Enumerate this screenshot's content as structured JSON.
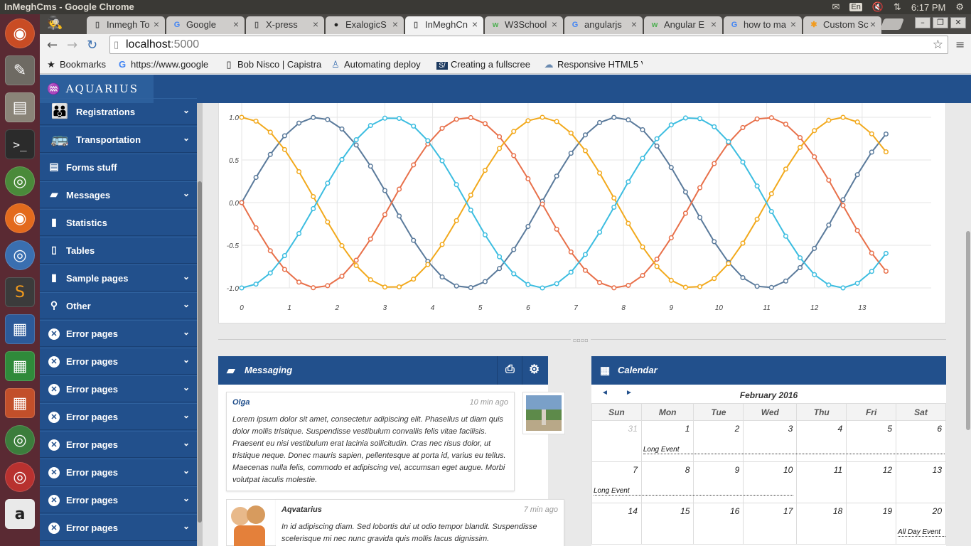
{
  "os": {
    "window_title": "InMeghCms - Google Chrome",
    "lang": "En",
    "time": "6:17 PM"
  },
  "tabs": [
    {
      "label": "Inmegh To",
      "favicon": "doc-icon"
    },
    {
      "label": "Google",
      "favicon": "google-icon"
    },
    {
      "label": "X-press",
      "favicon": "doc-icon"
    },
    {
      "label": "ExalogicS",
      "favicon": "github-icon"
    },
    {
      "label": "InMeghCn",
      "favicon": "doc-icon",
      "active": true
    },
    {
      "label": "W3School",
      "favicon": "w3schools-icon"
    },
    {
      "label": "angularjs",
      "favicon": "google-icon"
    },
    {
      "label": "Angular E",
      "favicon": "w3schools-icon"
    },
    {
      "label": "how to ma",
      "favicon": "google-icon"
    },
    {
      "label": "Custom Sc",
      "favicon": "star-icon"
    }
  ],
  "omnibox": {
    "host": "localhost",
    "port": ":5000"
  },
  "bookmarks": [
    {
      "label": "Bookmarks",
      "icon": "star-icon"
    },
    {
      "label": "https://www.google",
      "icon": "google-icon"
    },
    {
      "label": "Bob Nisco | Capistra",
      "icon": "doc-icon"
    },
    {
      "label": "Automating deploy",
      "icon": "rocket-icon"
    },
    {
      "label": "Creating a fullscree",
      "icon": "s-icon"
    },
    {
      "label": "Responsive HTML5 V",
      "icon": "cloud-icon"
    }
  ],
  "app": {
    "logo": "AQUARIUS"
  },
  "sidebar": {
    "items": [
      {
        "label": "Registrations",
        "icon": "people-icon",
        "has_children": true
      },
      {
        "label": "Transportation",
        "icon": "bus-icon",
        "has_children": true
      },
      {
        "label": "Forms stuff",
        "icon": "form-icon",
        "has_children": false
      },
      {
        "label": "Messages",
        "icon": "chat-icon",
        "has_children": true
      },
      {
        "label": "Statistics",
        "icon": "bar-chart-icon",
        "has_children": false
      },
      {
        "label": "Tables",
        "icon": "document-icon",
        "has_children": false
      },
      {
        "label": "Sample pages",
        "icon": "pages-icon",
        "has_children": true
      },
      {
        "label": "Other",
        "icon": "search-icon",
        "has_children": true
      },
      {
        "label": "Error pages",
        "icon": "error-icon",
        "has_children": true
      },
      {
        "label": "Error pages",
        "icon": "error-icon",
        "has_children": true
      },
      {
        "label": "Error pages",
        "icon": "error-icon",
        "has_children": true
      },
      {
        "label": "Error pages",
        "icon": "error-icon",
        "has_children": true
      },
      {
        "label": "Error pages",
        "icon": "error-icon",
        "has_children": true
      },
      {
        "label": "Error pages",
        "icon": "error-icon",
        "has_children": true
      },
      {
        "label": "Error pages",
        "icon": "error-icon",
        "has_children": true
      },
      {
        "label": "Error pages",
        "icon": "error-icon",
        "has_children": true
      }
    ]
  },
  "chart_data": {
    "type": "line",
    "xlim": [
      0,
      14
    ],
    "ylim": [
      -1.0,
      1.0
    ],
    "x_ticks": [
      "0",
      "1",
      "2",
      "3",
      "4",
      "5",
      "6",
      "7",
      "8",
      "9",
      "10",
      "11",
      "12",
      "13"
    ],
    "y_ticks": [
      "1.0",
      "0.5",
      "0.0",
      "-0.5",
      "-1.0"
    ],
    "grid": true,
    "x": [
      0,
      0.3,
      0.6,
      0.9,
      1.2,
      1.5,
      1.8,
      2.1,
      2.4,
      2.7,
      3.0,
      3.3,
      3.6,
      3.9,
      4.2,
      4.5,
      4.8,
      5.1,
      5.4,
      5.7,
      6.0,
      6.3,
      6.6,
      6.9,
      7.2,
      7.5,
      7.8,
      8.1,
      8.4,
      8.7,
      9.0,
      9.3,
      9.6,
      9.9,
      10.2,
      10.5,
      10.8,
      11.1,
      11.4,
      11.7,
      12.0,
      12.3,
      12.6,
      12.9,
      13.2,
      13.5
    ],
    "series": [
      {
        "color": "#5a7a9b",
        "values": [
          0,
          0.2955,
          0.5646,
          0.7833,
          0.932,
          0.9975,
          0.9738,
          0.8632,
          0.6755,
          0.4274,
          0.1411,
          -0.1577,
          -0.4425,
          -0.6878,
          -0.8716,
          -0.9775,
          -0.9962,
          -0.9258,
          -0.7728,
          -0.5507,
          -0.2794,
          0.0168,
          0.3115,
          0.5784,
          0.7937,
          0.938,
          0.9985,
          0.9699,
          0.8546,
          0.6628,
          0.4121,
          0.1245,
          -0.1743,
          -0.4575,
          -0.6999,
          -0.8797,
          -0.9809,
          -0.9946,
          -0.9193,
          -0.7619,
          -0.5366,
          -0.2632,
          0.0336,
          0.3275,
          0.592,
          0.8038
        ]
      },
      {
        "color": "#e8704a",
        "values": [
          0,
          -0.2955,
          -0.5646,
          -0.7833,
          -0.932,
          -0.9975,
          -0.9738,
          -0.8632,
          -0.6755,
          -0.4274,
          -0.1411,
          0.1577,
          0.4425,
          0.6878,
          0.8716,
          0.9775,
          0.9962,
          0.9258,
          0.7728,
          0.5507,
          0.2794,
          -0.0168,
          -0.3115,
          -0.5784,
          -0.7937,
          -0.938,
          -0.9985,
          -0.9699,
          -0.8546,
          -0.6628,
          -0.4121,
          -0.1245,
          0.1743,
          0.4575,
          0.6999,
          0.8797,
          0.9809,
          0.9946,
          0.9193,
          0.7619,
          0.5366,
          0.2632,
          -0.0336,
          -0.3275,
          -0.592,
          -0.8038
        ]
      },
      {
        "color": "#f2a91c",
        "values": [
          1,
          0.9553,
          0.8253,
          0.6216,
          0.3624,
          0.0707,
          -0.2272,
          -0.5048,
          -0.7374,
          -0.9041,
          -0.99,
          -0.9875,
          -0.8968,
          -0.7259,
          -0.4903,
          -0.2108,
          0.0875,
          0.378,
          0.6347,
          0.8347,
          0.9602,
          0.9999,
          0.9502,
          0.8157,
          0.6084,
          0.3466,
          0.054,
          -0.2435,
          -0.5193,
          -0.7487,
          -0.9111,
          -0.9922,
          -0.9847,
          -0.8892,
          -0.7143,
          -0.4755,
          -0.1943,
          0.1042,
          0.3935,
          0.6476,
          0.8439,
          0.9648,
          0.9994,
          0.9449,
          0.8059,
          0.595
        ]
      },
      {
        "color": "#3cbde0",
        "values": [
          -1,
          -0.9553,
          -0.8253,
          -0.6216,
          -0.3624,
          -0.0707,
          0.2272,
          0.5048,
          0.7374,
          0.9041,
          0.99,
          0.9875,
          0.8968,
          0.7259,
          0.4903,
          0.2108,
          -0.0875,
          -0.378,
          -0.6347,
          -0.8347,
          -0.9602,
          -0.9999,
          -0.9502,
          -0.8157,
          -0.6084,
          -0.3466,
          -0.054,
          0.2435,
          0.5193,
          0.7487,
          0.9111,
          0.9922,
          0.9847,
          0.8892,
          0.7143,
          0.4755,
          0.1943,
          -0.1042,
          -0.3935,
          -0.6476,
          -0.8439,
          -0.9648,
          -0.9994,
          -0.9449,
          -0.8059,
          -0.595
        ]
      }
    ]
  },
  "messaging": {
    "title": "Messaging",
    "messages": [
      {
        "author": "Olga",
        "time": "10 min ago",
        "text": "Lorem ipsum dolor sit amet, consectetur adipiscing elit. Phasellus ut diam quis dolor mollis tristique. Suspendisse vestibulum convallis felis vitae facilisis. Praesent eu nisi vestibulum erat lacinia sollicitudin. Cras nec risus dolor, ut tristique neque. Donec mauris sapien, pellentesque at porta id, varius eu tellus. Maecenas nulla felis, commodo et adipiscing vel, accumsan eget augue. Morbi volutpat iaculis molestie."
      },
      {
        "author": "Aqvatarius",
        "time": "7 min ago",
        "text": "In id adipiscing diam. Sed lobortis dui ut odio tempor blandit. Suspendisse scelerisque mi nec nunc gravida quis mollis lacus dignissim."
      }
    ]
  },
  "calendar": {
    "title": "Calendar",
    "month": "February 2016",
    "prev": "◄",
    "next": "►",
    "weekdays": [
      "Sun",
      "Mon",
      "Tue",
      "Wed",
      "Thu",
      "Fri",
      "Sat"
    ],
    "weeks": [
      [
        "31",
        "1",
        "2",
        "3",
        "4",
        "5",
        "6"
      ],
      [
        "7",
        "8",
        "9",
        "10",
        "11",
        "12",
        "13"
      ],
      [
        "14",
        "15",
        "16",
        "17",
        "18",
        "19",
        "20"
      ]
    ],
    "events": [
      {
        "label": "Long Event"
      },
      {
        "label": "Long Event"
      },
      {
        "label": "All Day Event"
      }
    ]
  }
}
